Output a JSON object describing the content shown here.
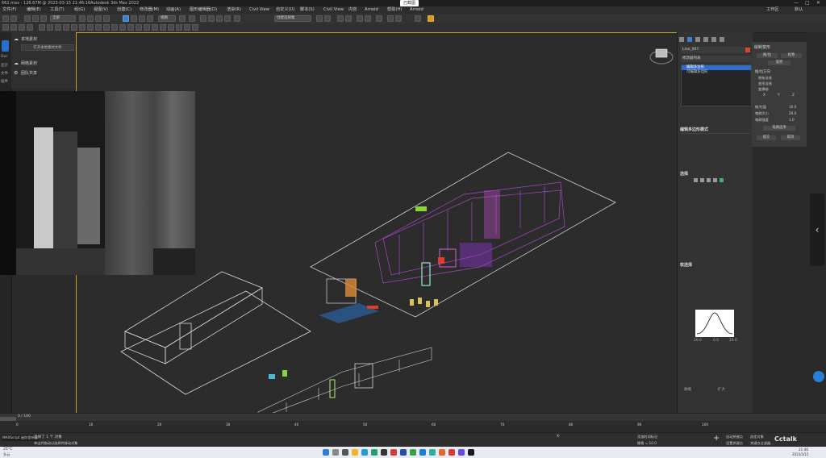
{
  "window": {
    "title": "Autodesk 3ds Max 2022",
    "file_info": "662.max - 126.67M @ 2023-03-15 21:46:16",
    "top_center_label": "已截图",
    "top_right_1": "工作区",
    "top_right_2": "默认"
  },
  "menu": {
    "items": [
      "文件(F)",
      "编辑(E)",
      "工具(T)",
      "组(G)",
      "视图(V)",
      "创建(C)",
      "修改器(M)",
      "动画(A)",
      "图形编辑器(D)",
      "渲染(R)",
      "Civil View",
      "自定义(U)",
      "脚本(S)",
      "Civil View",
      "内容",
      "Arnold",
      "帮助(H)",
      "Arnold"
    ]
  },
  "toolbar": {
    "dropdown_all": "全部",
    "dropdown_view": "视图",
    "dropdown_selection": "创建选择集"
  },
  "left_strip": {
    "items": [
      "Doc",
      "显示",
      "文件",
      "插件"
    ]
  },
  "left_panel": {
    "local_material": "本地素材",
    "open_local_button": "打开本地素材文件",
    "network_material": "网络素材",
    "team_share": "团队共享"
  },
  "right_panel": {
    "object_name": "Line_007",
    "modifier_list": "修改器列表",
    "stack": [
      "编辑多边形",
      "可编辑多边形"
    ],
    "section_edit_mode": "编辑多边形模式",
    "section_select": "选择",
    "section_soft_select": "软选择",
    "section_soft_label": "软选择",
    "curve_labels": [
      "20.0",
      "0.0",
      "20.0"
    ],
    "buttons": [
      "收缩",
      "扩大"
    ]
  },
  "side_panel": {
    "title": "绘制变形",
    "btn_push": "推/拉",
    "btn_relax": "松弛",
    "btn_revert": "复原",
    "section": "推/拉方向",
    "options": [
      "原始法线",
      "变形法线",
      "变换轴"
    ],
    "axis": [
      "X",
      "Y",
      "Z"
    ],
    "labels": [
      "推/拉值",
      "笔刷大小",
      "笔刷强度"
    ],
    "values": [
      "10.0",
      "20.0",
      "1.0"
    ],
    "btn_options": "笔刷选项",
    "btn_commit": "提交",
    "btn_cancel": "取消"
  },
  "timeline": {
    "frame": "0 / 100",
    "ticks": [
      "0",
      "10",
      "20",
      "30",
      "40",
      "50",
      "60",
      "70",
      "80",
      "90",
      "100"
    ]
  },
  "status": {
    "left_label": "MAXScript 迷你侦听器",
    "selection": "选择了 1 个 对象",
    "hint": "单击并拖动以选择并移动对象",
    "x": "X: ",
    "grid": "栅格 = 10.0",
    "time_tag": "添加时间标记",
    "auto_key": "自动关键点",
    "set_key": "设置关键点",
    "selected_obj": "选定对象",
    "key_filter": "关键点过滤器..."
  },
  "taskbar": {
    "weather_temp": "25°C",
    "weather_desc": "多云",
    "tray_time": "21:46",
    "tray_date": "2023/3/15",
    "watermark": "Cctalk"
  },
  "colors": {
    "accent_yellow": "#c9a21c",
    "selection_blue": "#3a7fc8",
    "wire_magenta": "#b44ad8",
    "wire_white": "#d6d6d6"
  }
}
